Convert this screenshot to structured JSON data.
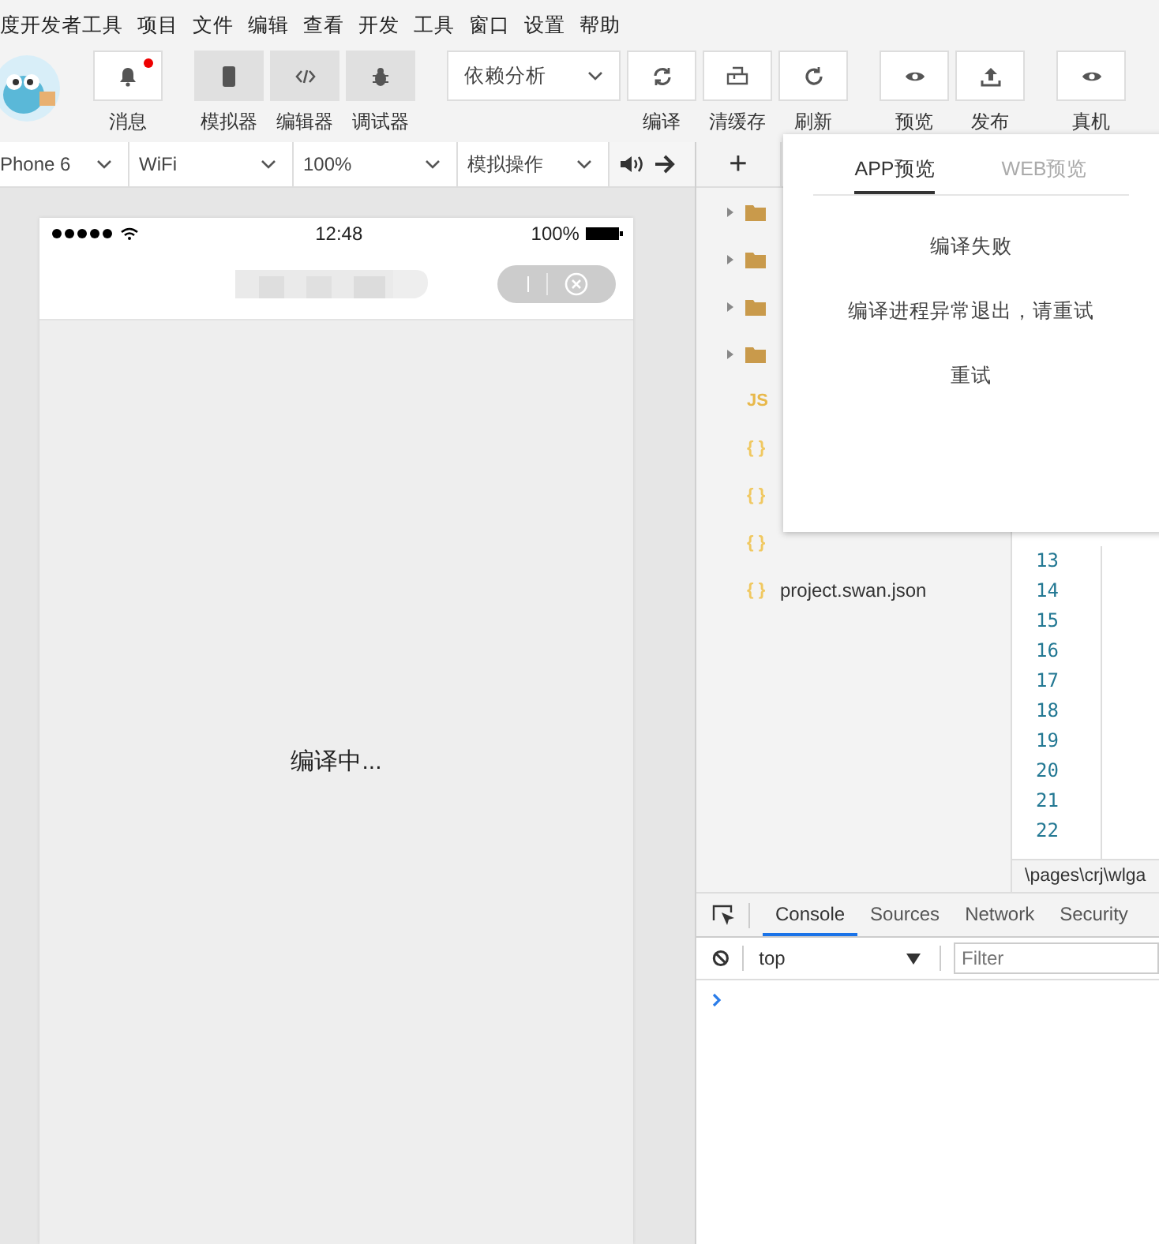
{
  "menu": [
    "度开发者工具",
    "项目",
    "文件",
    "编辑",
    "查看",
    "开发",
    "工具",
    "窗口",
    "设置",
    "帮助"
  ],
  "toolbar": {
    "groups": [
      [
        {
          "kind": "button",
          "label": "消息",
          "badge": true
        }
      ],
      [
        {
          "kind": "toggle",
          "label": "模拟器",
          "on": true
        },
        {
          "kind": "toggle",
          "label": "编辑器",
          "on": true
        },
        {
          "kind": "toggle",
          "label": "调试器",
          "on": true
        }
      ],
      [
        {
          "kind": "dropdown",
          "label": "依赖分析"
        },
        {
          "kind": "button",
          "label": "编译"
        },
        {
          "kind": "button",
          "label": "清缓存"
        },
        {
          "kind": "button",
          "label": "刷新"
        }
      ],
      [
        {
          "kind": "button",
          "label": "预览"
        },
        {
          "kind": "button",
          "label": "发布"
        }
      ],
      [
        {
          "kind": "button",
          "label": "真机"
        }
      ]
    ]
  },
  "sim_bar": {
    "selects": [
      "Phone 6",
      "WiFi",
      "100%",
      "模拟操作"
    ]
  },
  "phone": {
    "time": "12:48",
    "battery": "100%",
    "body_text": "编译中..."
  },
  "file_tree": {
    "add": "+",
    "items": [
      {
        "kind": "folder"
      },
      {
        "kind": "folder"
      },
      {
        "kind": "folder"
      },
      {
        "kind": "folder"
      },
      {
        "kind": "file",
        "icon": "JS",
        "color": "#e8b84a"
      },
      {
        "kind": "file",
        "icon": "{ }",
        "color": "#f0c860"
      },
      {
        "kind": "file",
        "icon": "{ }",
        "color": "#f0c860"
      },
      {
        "kind": "file",
        "icon": "{ }",
        "color": "#f0c860"
      },
      {
        "kind": "file",
        "icon": "{ }",
        "color": "#f0c860",
        "name": "project.swan.json"
      }
    ]
  },
  "code": {
    "line_numbers": [
      "13",
      "14",
      "15",
      "16",
      "17",
      "18",
      "19",
      "20",
      "21",
      "22"
    ],
    "path": "\\pages\\crj\\wlga"
  },
  "devtools": {
    "tabs": [
      {
        "label": "Console",
        "selected": true
      },
      {
        "label": "Sources",
        "selected": false
      },
      {
        "label": "Network",
        "selected": false
      },
      {
        "label": "Security",
        "selected": false
      }
    ],
    "context": "top",
    "filter": {
      "placeholder": "Filter"
    }
  },
  "popup": {
    "tabs": [
      {
        "label": "APP预览",
        "selected": true
      },
      {
        "label": "WEB预览",
        "selected": false
      }
    ],
    "title": "编译失败",
    "message": "编译进程异常退出，请重试",
    "retry": "重试"
  }
}
